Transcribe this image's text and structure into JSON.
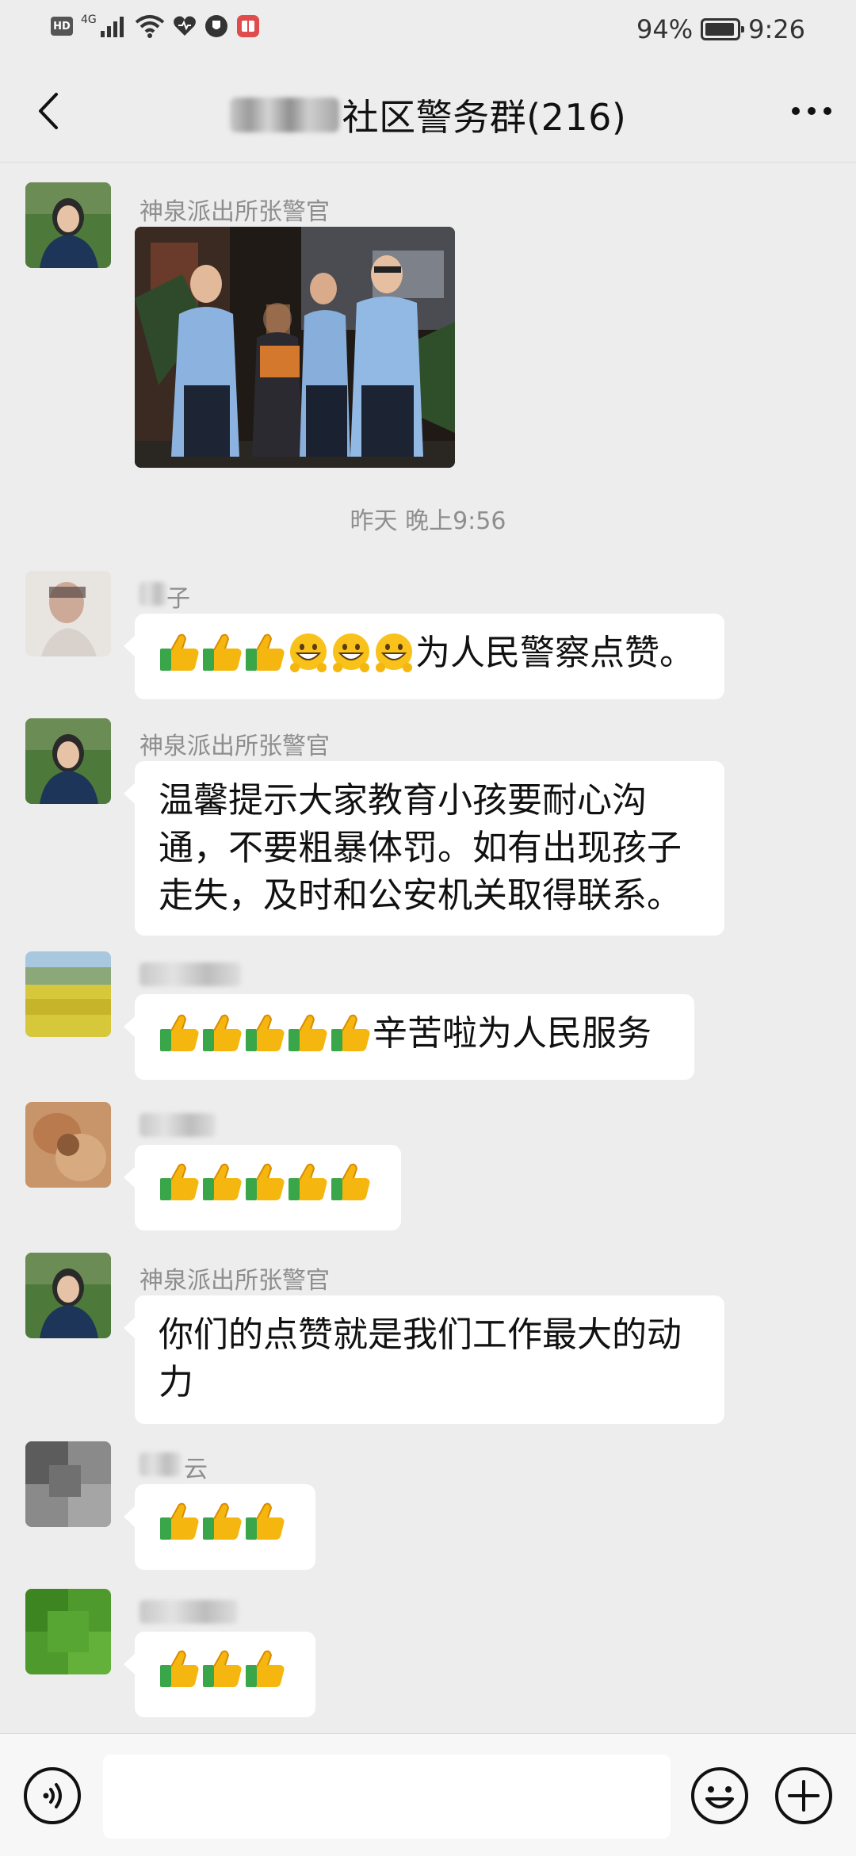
{
  "status_bar": {
    "hd_label": "HD",
    "network_label": "4G",
    "battery_text": "94%",
    "battery_level": 0.94,
    "time": "9:26"
  },
  "nav": {
    "title": "社区警务群(216)"
  },
  "chat": {
    "messages": [
      {
        "sender": "神泉派出所张警官",
        "type": "image"
      },
      {
        "timestamp": "昨天 晚上9:56"
      },
      {
        "sender": "子",
        "emojis": [
          "thumbs-up",
          "thumbs-up",
          "thumbs-up",
          "grin",
          "grin",
          "grin"
        ],
        "text": "为人民警察点赞。"
      },
      {
        "sender": "神泉派出所张警官",
        "lines": [
          "温馨提示大家教育小孩要耐心沟",
          "通，不要粗暴体罚。如有出现孩子",
          "走失，及时和公安机关取得联系。"
        ]
      },
      {
        "sender": "",
        "emojis": [
          "thumbs-up",
          "thumbs-up",
          "thumbs-up",
          "thumbs-up",
          "thumbs-up"
        ],
        "text": "辛苦啦为人民服务"
      },
      {
        "sender": "",
        "emojis": [
          "thumbs-up",
          "thumbs-up",
          "thumbs-up",
          "thumbs-up",
          "thumbs-up"
        ],
        "text": ""
      },
      {
        "sender": "神泉派出所张警官",
        "lines": [
          "你们的点赞就是我们工作最大的动",
          "力"
        ]
      },
      {
        "sender": "云",
        "emojis": [
          "thumbs-up",
          "thumbs-up",
          "thumbs-up"
        ],
        "text": ""
      },
      {
        "sender": "",
        "emojis": [
          "thumbs-up",
          "thumbs-up",
          "thumbs-up"
        ],
        "text": ""
      }
    ]
  },
  "colors": {
    "background": "#ededed",
    "bubble": "#ffffff",
    "meta_text": "#8e8e8e"
  },
  "icons": [
    "hd-icon",
    "signal-icon",
    "wifi-icon",
    "heart-icon",
    "shield-icon",
    "app-icon",
    "battery-icon",
    "back-icon",
    "more-icon",
    "voice-icon",
    "emoji-icon",
    "plus-icon",
    "thumbs-up-icon",
    "grin-icon"
  ]
}
